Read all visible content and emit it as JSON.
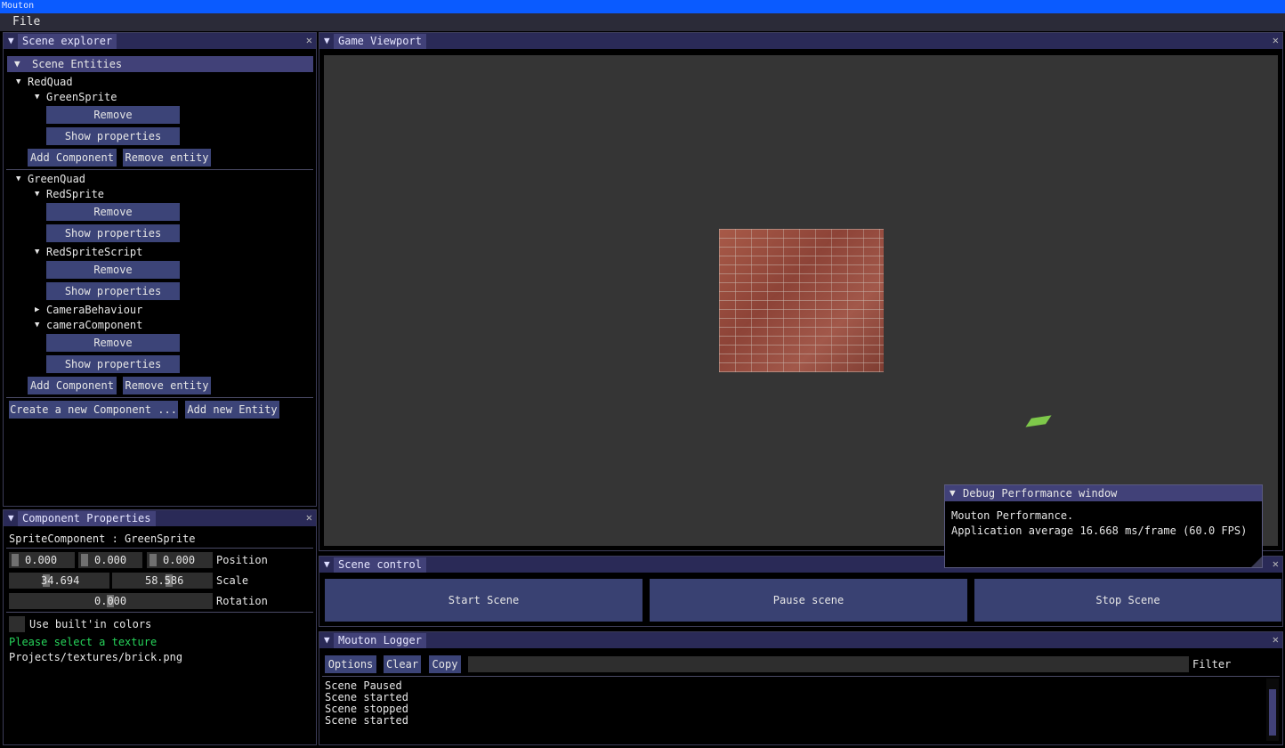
{
  "app": {
    "title": "Mouton"
  },
  "menu": {
    "file": "File"
  },
  "scene_explorer": {
    "title": "Scene explorer",
    "header": "Scene Entities",
    "entities": [
      {
        "name": "RedQuad",
        "components": [
          {
            "name": "GreenSprite",
            "expanded": true
          }
        ]
      },
      {
        "name": "GreenQuad",
        "components": [
          {
            "name": "RedSprite",
            "expanded": true
          },
          {
            "name": "RedSpriteScript",
            "expanded": true
          },
          {
            "name": "CameraBehaviour",
            "expanded": false
          },
          {
            "name": "cameraComponent",
            "expanded": true
          }
        ]
      }
    ],
    "remove_label": "Remove",
    "show_props_label": "Show properties",
    "add_component_label": "Add Component",
    "remove_entity_label": "Remove entity",
    "create_component_label": "Create a new Component ...",
    "add_entity_label": "Add new Entity"
  },
  "component_properties": {
    "title": "Component Properties",
    "heading": "SpriteComponent : GreenSprite",
    "position": {
      "x": "0.000",
      "y": "0.000",
      "z": "0.000",
      "label": "Position"
    },
    "scale": {
      "x": "34.694",
      "y": "58.586",
      "label": "Scale"
    },
    "rotation": {
      "value": "0.000",
      "label": "Rotation"
    },
    "builtin_colors_label": "Use built'in colors",
    "texture_prompt": "Please select a texture",
    "texture_path": "Projects/textures/brick.png"
  },
  "game_viewport": {
    "title": "Game Viewport"
  },
  "debug_window": {
    "title": "Debug Performance window",
    "line1": "Mouton Performance.",
    "line2": "Application average 16.668 ms/frame (60.0 FPS)"
  },
  "scene_control": {
    "title": "Scene control",
    "start": "Start Scene",
    "pause": "Pause scene",
    "stop": "Stop Scene"
  },
  "logger": {
    "title": "Mouton Logger",
    "options": "Options",
    "clear": "Clear",
    "copy": "Copy",
    "filter": "Filter",
    "lines": [
      "Scene Paused",
      "Scene started",
      "Scene stopped",
      "Scene started"
    ]
  },
  "colors": {
    "accent": "#414178",
    "title_bar": "#0a5bff",
    "button": "#3c4478",
    "texture_prompt": "#26d35a"
  },
  "icons": {
    "collapse": "triangle-down-icon",
    "expand": "triangle-right-icon",
    "close": "close-icon"
  }
}
